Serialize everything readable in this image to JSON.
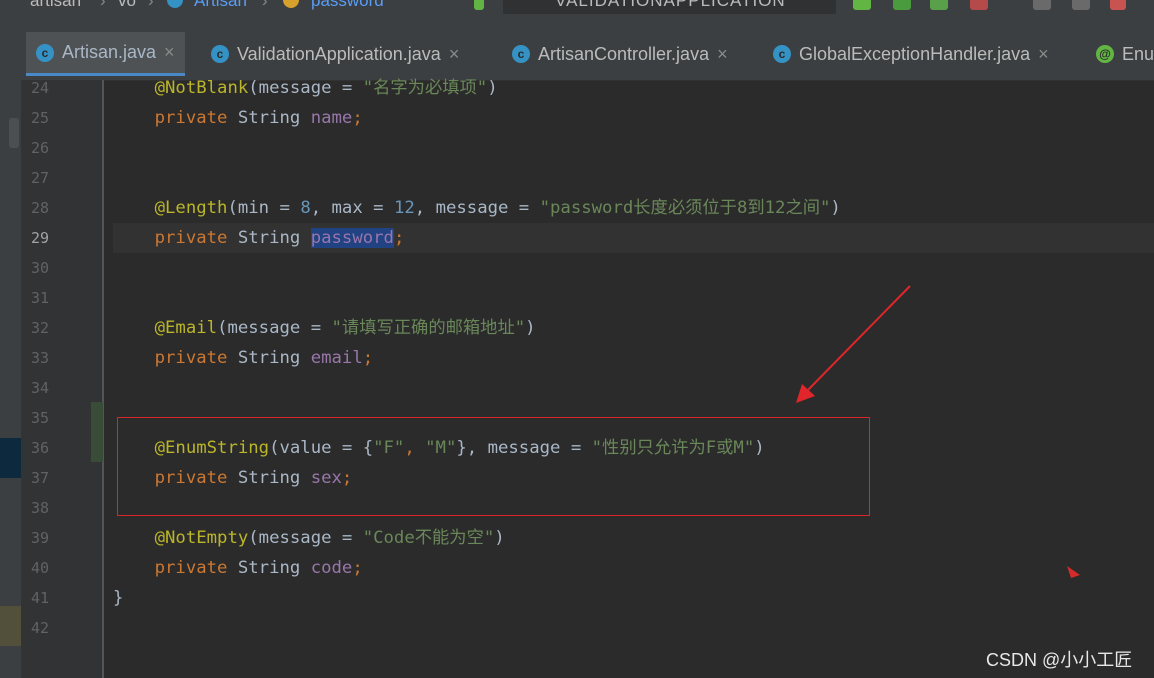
{
  "breadcrumb": {
    "items": [
      "artisan",
      "vo",
      "Artisan",
      "password"
    ]
  },
  "run_config": "VALIDATIONAPPLICATION",
  "tabs": [
    {
      "label": "Artisan.java",
      "active": true,
      "icon": "class-icon"
    },
    {
      "label": "ValidationApplication.java",
      "active": false,
      "icon": "spring-class-icon"
    },
    {
      "label": "ArtisanController.java",
      "active": false,
      "icon": "class-icon"
    },
    {
      "label": "GlobalExceptionHandler.java",
      "active": false,
      "icon": "class-icon"
    },
    {
      "label": "Enu",
      "active": false,
      "icon": "annotation-icon"
    }
  ],
  "tab_close": "×",
  "line_numbers": [
    "24",
    "25",
    "26",
    "27",
    "28",
    "29",
    "30",
    "31",
    "32",
    "33",
    "34",
    "35",
    "36",
    "37",
    "38",
    "39",
    "40",
    "41",
    "42"
  ],
  "current_line": "29",
  "code": {
    "l24": {
      "ann": "@NotBlank",
      "p1": "(message = ",
      "s1": "\"名字为必填项\"",
      "p2": ")"
    },
    "l25": {
      "kw": "private ",
      "type": "String ",
      "fld": "name",
      "end": ";"
    },
    "l28": {
      "ann": "@Length",
      "p1": "(min = ",
      "n1": "8",
      "p2": ", max = ",
      "n2": "12",
      "p3": ", message = ",
      "s1": "\"password长度必须位于8到12之间\"",
      "p4": ")"
    },
    "l29": {
      "kw": "private ",
      "type": "String ",
      "fld": "password",
      "end": ";"
    },
    "l32": {
      "ann": "@Email",
      "p1": "(message = ",
      "s1": "\"请填写正确的邮箱地址\"",
      "p2": ")"
    },
    "l33": {
      "kw": "private ",
      "type": "String ",
      "fld": "email",
      "end": ";"
    },
    "l36": {
      "ann": "@EnumString",
      "p1": "(value = {",
      "s1": "\"F\"",
      "p2": ", ",
      "s2": "\"M\"",
      "p3": "}, message = ",
      "s3": "\"性别只允许为F或M\"",
      "p4": ")"
    },
    "l37": {
      "kw": "private ",
      "type": "String ",
      "fld": "sex",
      "end": ";"
    },
    "l39": {
      "ann": "@NotEmpty",
      "p1": "(message = ",
      "s1": "\"Code不能为空\"",
      "p2": ")"
    },
    "l40": {
      "kw": "private ",
      "type": "String ",
      "fld": "code",
      "end": ";"
    },
    "l41": {
      "text": "}"
    }
  },
  "watermark": "CSDN @小小工匠",
  "colors": {
    "editor_bg": "#2b2b2b",
    "annotation": "#bbb529",
    "keyword": "#cc7832",
    "string": "#6a8759",
    "number": "#6897bb",
    "field": "#9876aa",
    "highlight_box": "#d9262b",
    "arrow": "#e0262b"
  }
}
